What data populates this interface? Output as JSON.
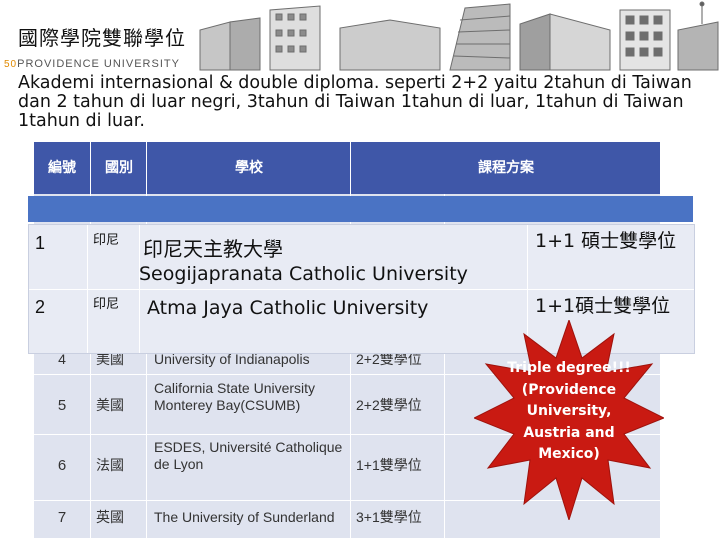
{
  "header": {
    "title": "國際學院雙聯學位",
    "university_number": "50",
    "university_name": "PROVIDENCE UNIVERSITY"
  },
  "intro_text": "Akademi internasional & double diploma. seperti 2+2 yaitu 2tahun di Taiwan dan 2 tahun di luar negri, 3tahun di Taiwan 1tahun di luar, 1tahun di Taiwan 1tahun di luar.",
  "background_table": {
    "columns": [
      "編號",
      "國別",
      "學校",
      "課程方案"
    ],
    "rows": [
      {
        "num": "4",
        "country": "美國",
        "school": "University of Indianapolis",
        "program": "2+2雙學位"
      },
      {
        "num": "5",
        "country": "美國",
        "school": "California State University Monterey Bay(CSUMB)",
        "program": "2+2雙學位"
      },
      {
        "num": "6",
        "country": "法國",
        "school": "ESDES, Université Catholique de Lyon",
        "program": "1+1雙學位"
      },
      {
        "num": "7",
        "country": "英國",
        "school": "The University of Sunderland",
        "program": "3+1雙學位"
      }
    ]
  },
  "overlay_table": {
    "rows": [
      {
        "num": "1",
        "country": "印尼",
        "school_zh": "印尼天主教大學",
        "school_en": "Seogijapranata Catholic University",
        "program": "1+1 碩士雙學位"
      },
      {
        "num": "2",
        "country": "印尼",
        "school_zh": "",
        "school_en": "Atma Jaya Catholic University",
        "program": "1+1碩士雙學位"
      }
    ]
  },
  "callout": {
    "text": "Triple degree!!! (Providence University, Austria and Mexico)",
    "color": "#c91a12"
  }
}
